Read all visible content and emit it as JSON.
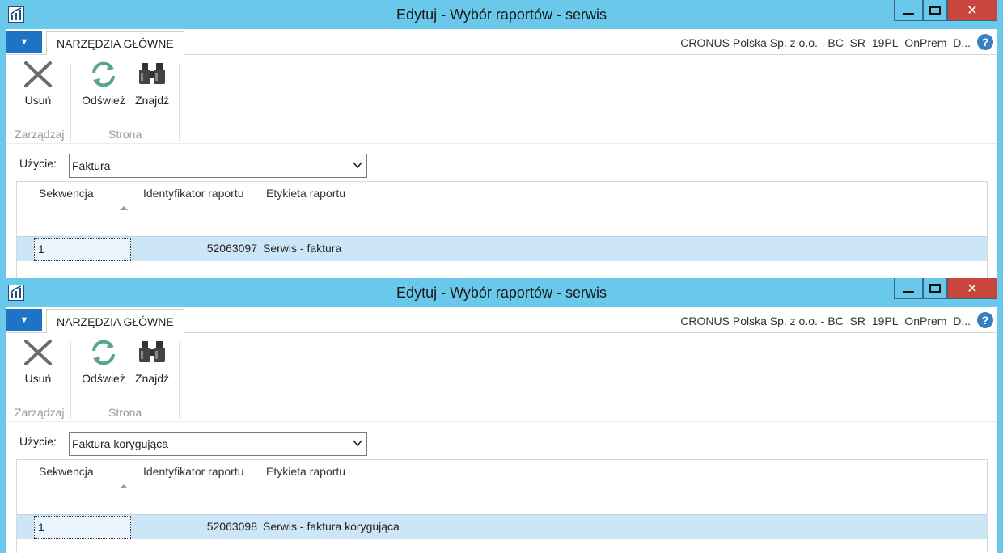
{
  "colors": {
    "titlebar": "#6ac8ea",
    "close_button": "#c9463d",
    "app_menu": "#1e73c4",
    "selected_row": "#cce5f7",
    "refresh_icon": "#5aa58a"
  },
  "windows": [
    {
      "title": "Edytuj - Wybór raportów - serwis",
      "tab_home": "NARZĘDZIA GŁÓWNE",
      "company": "CRONUS Polska Sp. z o.o. - BC_SR_19PL_OnPrem_D...",
      "help": "?",
      "ribbon": {
        "delete_label": "Usuń",
        "refresh_label": "Odśwież",
        "find_label": "Znajdź",
        "group_manage": "Zarządzaj",
        "group_page": "Strona"
      },
      "usage_label": "Użycie:",
      "usage_value": "Faktura",
      "columns": [
        "Sekwencja",
        "Identyfikator raportu",
        "Etykieta raportu"
      ],
      "rows": [
        {
          "sequence": "1",
          "report_id": "52063097",
          "report_label": "Serwis - faktura"
        }
      ]
    },
    {
      "title": "Edytuj - Wybór raportów - serwis",
      "tab_home": "NARZĘDZIA GŁÓWNE",
      "company": "CRONUS Polska Sp. z o.o. - BC_SR_19PL_OnPrem_D...",
      "help": "?",
      "ribbon": {
        "delete_label": "Usuń",
        "refresh_label": "Odśwież",
        "find_label": "Znajdź",
        "group_manage": "Zarządzaj",
        "group_page": "Strona"
      },
      "usage_label": "Użycie:",
      "usage_value": "Faktura korygująca",
      "columns": [
        "Sekwencja",
        "Identyfikator raportu",
        "Etykieta raportu"
      ],
      "rows": [
        {
          "sequence": "1",
          "report_id": "52063098",
          "report_label": "Serwis - faktura korygująca"
        }
      ]
    }
  ]
}
